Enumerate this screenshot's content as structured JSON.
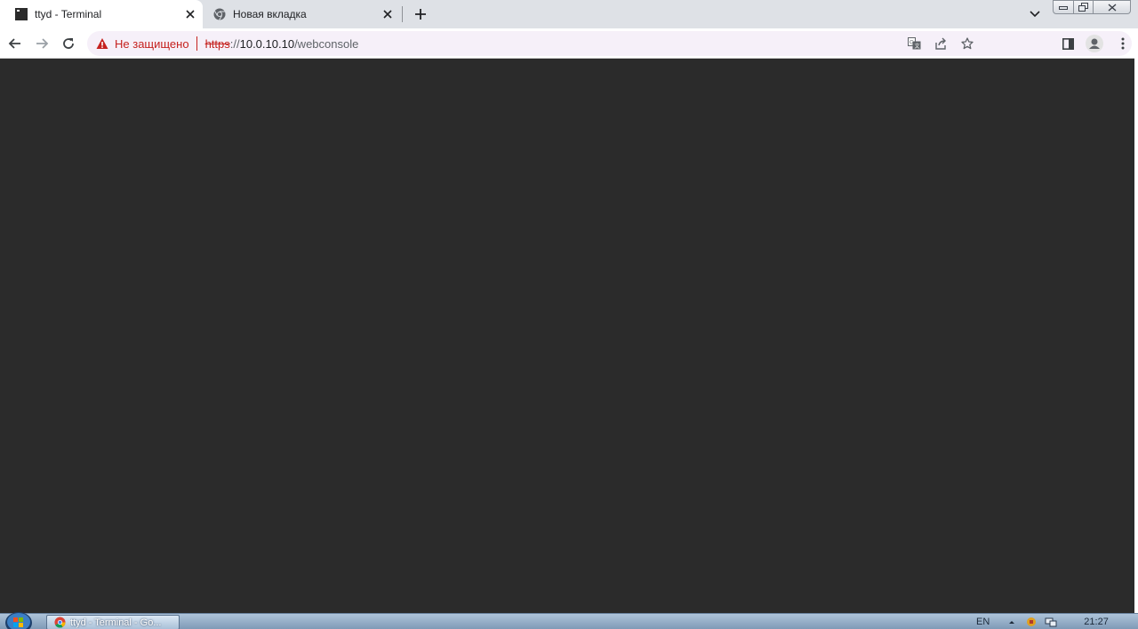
{
  "browser": {
    "tabs": [
      {
        "title": "ttyd - Terminal",
        "favicon": "terminal-icon",
        "active": true
      },
      {
        "title": "Новая вкладка",
        "favicon": "chrome-icon",
        "active": false
      }
    ],
    "omnibox": {
      "security_label": "Не защищено",
      "url_scheme": "https",
      "url_separator": "://",
      "url_host": "10.0.10.10",
      "url_path": "/webconsole"
    }
  },
  "content": {
    "background": "#2b2b2b"
  },
  "taskbar": {
    "task_label": "ttyd - Terminal - Go...",
    "language": "EN",
    "time": "21:27"
  },
  "colors": {
    "insecure": "#c5221f",
    "tabstrip": "#dee1e6",
    "omnibox": "#f6f0f9"
  }
}
